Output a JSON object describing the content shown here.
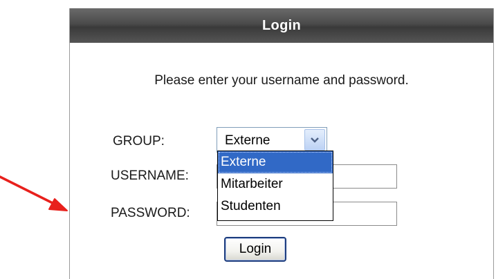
{
  "login": {
    "header_title": "Login",
    "instruction": "Please enter your username and password.",
    "group_label": "GROUP:",
    "group_selected": "Externe",
    "group_options": [
      "Externe",
      "Mitarbeiter",
      "Studenten"
    ],
    "username_label": "USERNAME:",
    "username_value": "",
    "password_label": "PASSWORD:",
    "password_value": "",
    "submit_label": "Login"
  },
  "colors": {
    "header_background": "#4a4a4a",
    "selected_option": "#3169c6",
    "annotation_arrow": "#e8201c"
  }
}
